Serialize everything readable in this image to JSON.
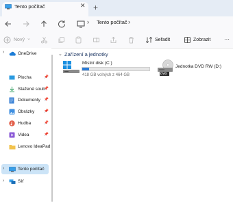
{
  "tab": {
    "title": "Tento počítač",
    "close_glyph": "✕",
    "new_tab_glyph": "+"
  },
  "address": {
    "path_label": "Tento počítač",
    "separator": "›"
  },
  "toolbar": {
    "new_label": "Nový",
    "new_chevron": "⌄",
    "sort_label": "Seřadit",
    "view_label": "Zobrazit",
    "more_label": "···"
  },
  "sidebar": {
    "items": [
      {
        "label": "OneDrive",
        "icon": "cloud-icon"
      },
      {
        "label": "Plocha",
        "icon": "desktop-icon",
        "pinned": true
      },
      {
        "label": "Stažené soub",
        "icon": "download-icon",
        "pinned": true
      },
      {
        "label": "Dokumenty",
        "icon": "document-icon",
        "pinned": true
      },
      {
        "label": "Obrázky",
        "icon": "pictures-icon",
        "pinned": true
      },
      {
        "label": "Hudba",
        "icon": "music-icon",
        "pinned": true
      },
      {
        "label": "Videa",
        "icon": "video-icon",
        "pinned": true
      },
      {
        "label": "Lenovo IdeaPad",
        "icon": "folder-icon"
      },
      {
        "label": "Tento počítač",
        "icon": "computer-icon",
        "selected": true
      },
      {
        "label": "Síť",
        "icon": "network-icon"
      }
    ],
    "pin_glyph": "📌",
    "expand_glyph": "›"
  },
  "main": {
    "section_title": "Zařízení a jednotky",
    "section_chevron": "⌄",
    "drives": [
      {
        "name": "Místní disk (C:)",
        "free_text": "418 GB volných z 464 GB",
        "used_fraction": 0.1
      },
      {
        "name": "Jednotka DVD RW (D:)",
        "badge": "DVD"
      }
    ]
  },
  "colors": {
    "accent": "#2b7bd6",
    "selection": "#cce4f7",
    "tabstrip": "#e5ecf5"
  }
}
